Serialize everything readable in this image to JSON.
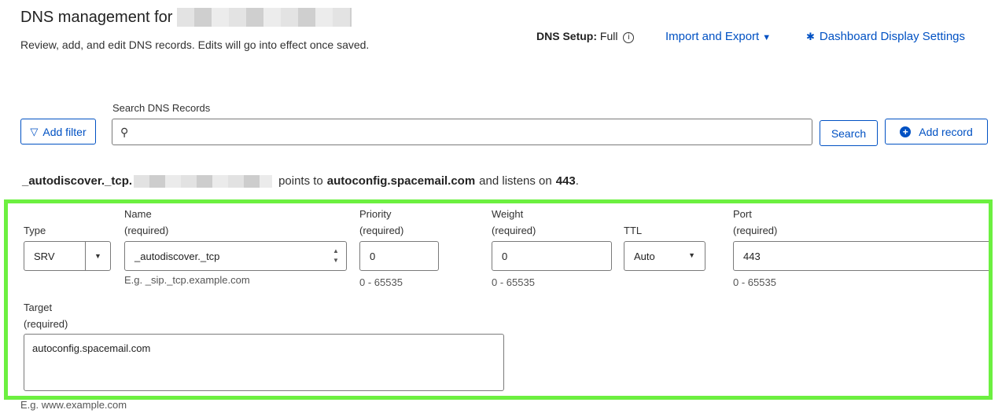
{
  "header": {
    "title": "DNS management for",
    "subtitle": "Review, add, and edit DNS records. Edits will go into effect once saved.",
    "dns_setup_label": "DNS Setup:",
    "dns_setup_value": "Full",
    "info_glyph": "i",
    "import_export": "Import and Export",
    "dashboard_settings": "Dashboard Display Settings"
  },
  "search": {
    "label": "Search DNS Records",
    "placeholder": "",
    "add_filter": "Add filter",
    "search_button": "Search",
    "add_record": "Add record"
  },
  "summary": {
    "name": "_autodiscover._tcp.",
    "points_to_text": "points to",
    "target": "autoconfig.spacemail.com",
    "listens_text": "and listens on",
    "port": "443",
    "period": "."
  },
  "form": {
    "type": {
      "label": "Type",
      "value": "SRV"
    },
    "name": {
      "label": "Name",
      "required": "(required)",
      "value": "_autodiscover._tcp",
      "hint": "E.g. _sip._tcp.example.com"
    },
    "priority": {
      "label": "Priority",
      "required": "(required)",
      "value": "0",
      "hint": "0 - 65535"
    },
    "weight": {
      "label": "Weight",
      "required": "(required)",
      "value": "0",
      "hint": "0 - 65535"
    },
    "ttl": {
      "label": "TTL",
      "value": "Auto"
    },
    "port": {
      "label": "Port",
      "required": "(required)",
      "value": "443",
      "hint": "0 - 65535"
    },
    "target": {
      "label": "Target",
      "required": "(required)",
      "value": "autoconfig.spacemail.com",
      "hint": "E.g. www.example.com"
    }
  },
  "colors": {
    "link": "#0051c3",
    "highlight": "#6cf040"
  }
}
